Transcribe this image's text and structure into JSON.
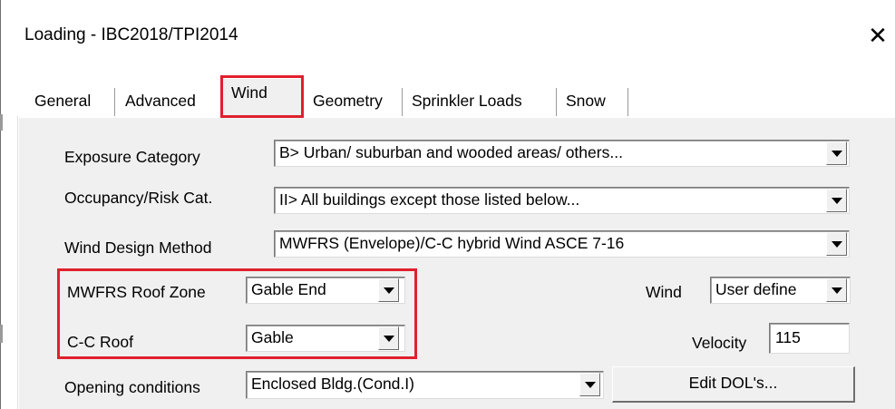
{
  "window": {
    "title": "Loading - IBC2018/TPI2014",
    "close_glyph": "✕"
  },
  "tabs": [
    {
      "label": "General"
    },
    {
      "label": "Advanced"
    },
    {
      "label": "Wind",
      "active": true
    },
    {
      "label": "Geometry"
    },
    {
      "label": "Sprinkler Loads"
    },
    {
      "label": "Snow"
    }
  ],
  "fields": {
    "exposure": {
      "label": "Exposure Category",
      "value": "B> Urban/ suburban and wooded areas/ others..."
    },
    "occupancy": {
      "label": "Occupancy/Risk Cat.",
      "value": "II> All buildings except those listed below..."
    },
    "design_method": {
      "label": "Wind Design Method",
      "value": "MWFRS (Envelope)/C-C hybrid Wind ASCE 7-16"
    },
    "mwfrs_roof_zone": {
      "label": "MWFRS Roof Zone",
      "value": "Gable End"
    },
    "cc_roof": {
      "label": "C-C Roof",
      "value": "Gable"
    },
    "wind": {
      "label": "Wind",
      "value": "User define"
    },
    "velocity": {
      "label": "Velocity",
      "value": "115"
    },
    "opening": {
      "label": "Opening conditions",
      "value": "Enclosed Bldg.(Cond.I)"
    }
  },
  "buttons": {
    "edit_dols": "Edit DOL's..."
  },
  "colors": {
    "highlight": "#e0202e",
    "panel": "#f0f0f0"
  }
}
